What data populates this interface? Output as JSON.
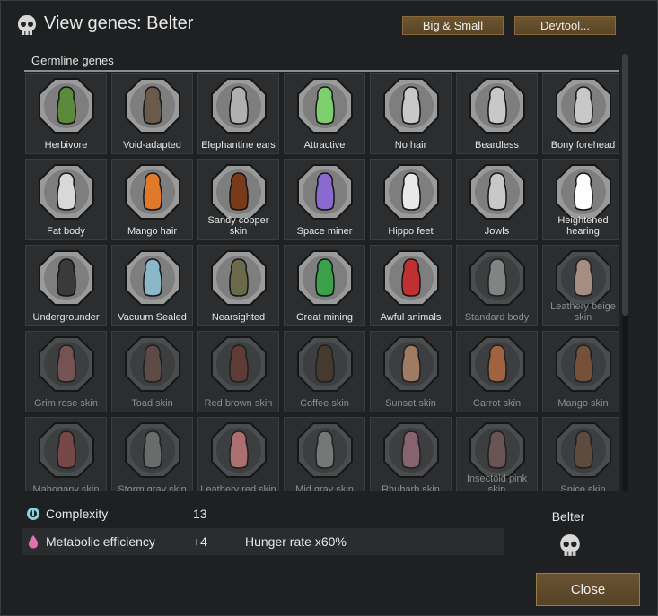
{
  "window": {
    "title": "View genes: Belter"
  },
  "toolbar": {
    "big_small_label": "Big & Small",
    "devtool_label": "Devtool..."
  },
  "section": {
    "label": "Germline genes"
  },
  "genes": [
    {
      "label": "Herbivore",
      "color": "#5b8a3c",
      "active": true
    },
    {
      "label": "Void-adapted",
      "color": "#6a5a4a",
      "active": true
    },
    {
      "label": "Elephantine ears",
      "color": "#b0b0b0",
      "active": true
    },
    {
      "label": "Attractive",
      "color": "#7ccf6c",
      "active": true
    },
    {
      "label": "No hair",
      "color": "#c8c8c8",
      "active": true
    },
    {
      "label": "Beardless",
      "color": "#c8c8c8",
      "active": true
    },
    {
      "label": "Bony forehead",
      "color": "#c8c8c8",
      "active": true
    },
    {
      "label": "Fat body",
      "color": "#d8d8d8",
      "active": true
    },
    {
      "label": "Mango hair",
      "color": "#e07a2a",
      "active": true
    },
    {
      "label": "Sandy copper skin",
      "color": "#7a3a1a",
      "active": true
    },
    {
      "label": "Space miner",
      "color": "#8a6ad0",
      "active": true
    },
    {
      "label": "Hippo feet",
      "color": "#e8e8e8",
      "active": true
    },
    {
      "label": "Jowls",
      "color": "#c8c8c8",
      "active": true
    },
    {
      "label": "Heightened hearing",
      "color": "#ffffff",
      "active": true
    },
    {
      "label": "Undergrounder",
      "color": "#3a3a3a",
      "active": true
    },
    {
      "label": "Vacuum Sealed",
      "color": "#8ab8c8",
      "active": true
    },
    {
      "label": "Nearsighted",
      "color": "#6a6a4a",
      "active": true
    },
    {
      "label": "Great mining",
      "color": "#3aa04a",
      "active": true
    },
    {
      "label": "Awful animals",
      "color": "#c03030",
      "active": true
    },
    {
      "label": "Standard body",
      "color": "#9a9a9a",
      "active": false
    },
    {
      "label": "Leathery beige skin",
      "color": "#c8a898",
      "active": false
    },
    {
      "label": "Grim rose skin",
      "color": "#8a5a5a",
      "active": false
    },
    {
      "label": "Toad skin",
      "color": "#6a5048",
      "active": false
    },
    {
      "label": "Red brown skin",
      "color": "#6a3a30",
      "active": false
    },
    {
      "label": "Coffee skin",
      "color": "#4a3828",
      "active": false
    },
    {
      "label": "Sunset skin",
      "color": "#c09070",
      "active": false
    },
    {
      "label": "Carrot skin",
      "color": "#c07040",
      "active": false
    },
    {
      "label": "Mango skin",
      "color": "#8a5838",
      "active": false
    },
    {
      "label": "Mahogany skin",
      "color": "#8a4a4a",
      "active": false
    },
    {
      "label": "Storm gray skin",
      "color": "#7a7a7a",
      "active": false
    },
    {
      "label": "Leathery red skin",
      "color": "#d08080",
      "active": false
    },
    {
      "label": "Mid gray skin",
      "color": "#8a8a8a",
      "active": false
    },
    {
      "label": "Rhubarb skin",
      "color": "#a07080",
      "active": false
    },
    {
      "label": "Insectoid pink skin",
      "color": "#7a5a5a",
      "active": false
    },
    {
      "label": "Spice skin",
      "color": "#6a5040",
      "active": false
    }
  ],
  "stats": {
    "complexity": {
      "label": "Complexity",
      "value": "13",
      "icon": "complexity-icon",
      "color": "#8ad0e0"
    },
    "metabolic": {
      "label": "Metabolic efficiency",
      "value": "+4",
      "desc": "Hunger rate x60%",
      "icon": "metabolism-icon",
      "color": "#e070b0"
    }
  },
  "xenotype": {
    "name": "Belter",
    "icon": "xenotype-skull-icon"
  },
  "buttons": {
    "close_label": "Close"
  },
  "colors": {
    "button_bg": "#5e4829",
    "button_border": "#8b6a3a"
  }
}
